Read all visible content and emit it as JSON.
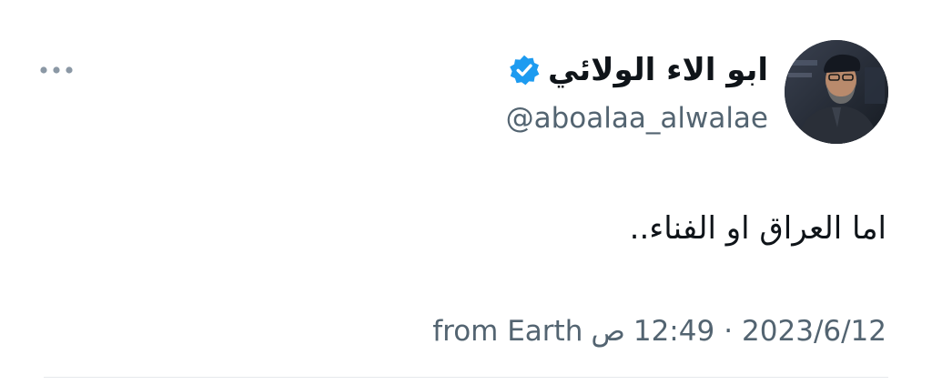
{
  "tweet": {
    "author": {
      "display_name": "ابو الاء الولائي",
      "handle": "@aboalaa_alwalae",
      "verified": true,
      "avatar_icon": "profile-photo-icon"
    },
    "text": "اما العراق او الفناء..",
    "meta": {
      "time": "12:49",
      "period": "ص",
      "separator": "·",
      "date": "2023/6/12",
      "source": "from Earth"
    },
    "more_icon": "more-dots-icon",
    "colors": {
      "text_primary": "#0f1419",
      "text_secondary": "#536471",
      "verified_blue": "#1d9bf0",
      "divider": "#e6e9ec"
    }
  }
}
